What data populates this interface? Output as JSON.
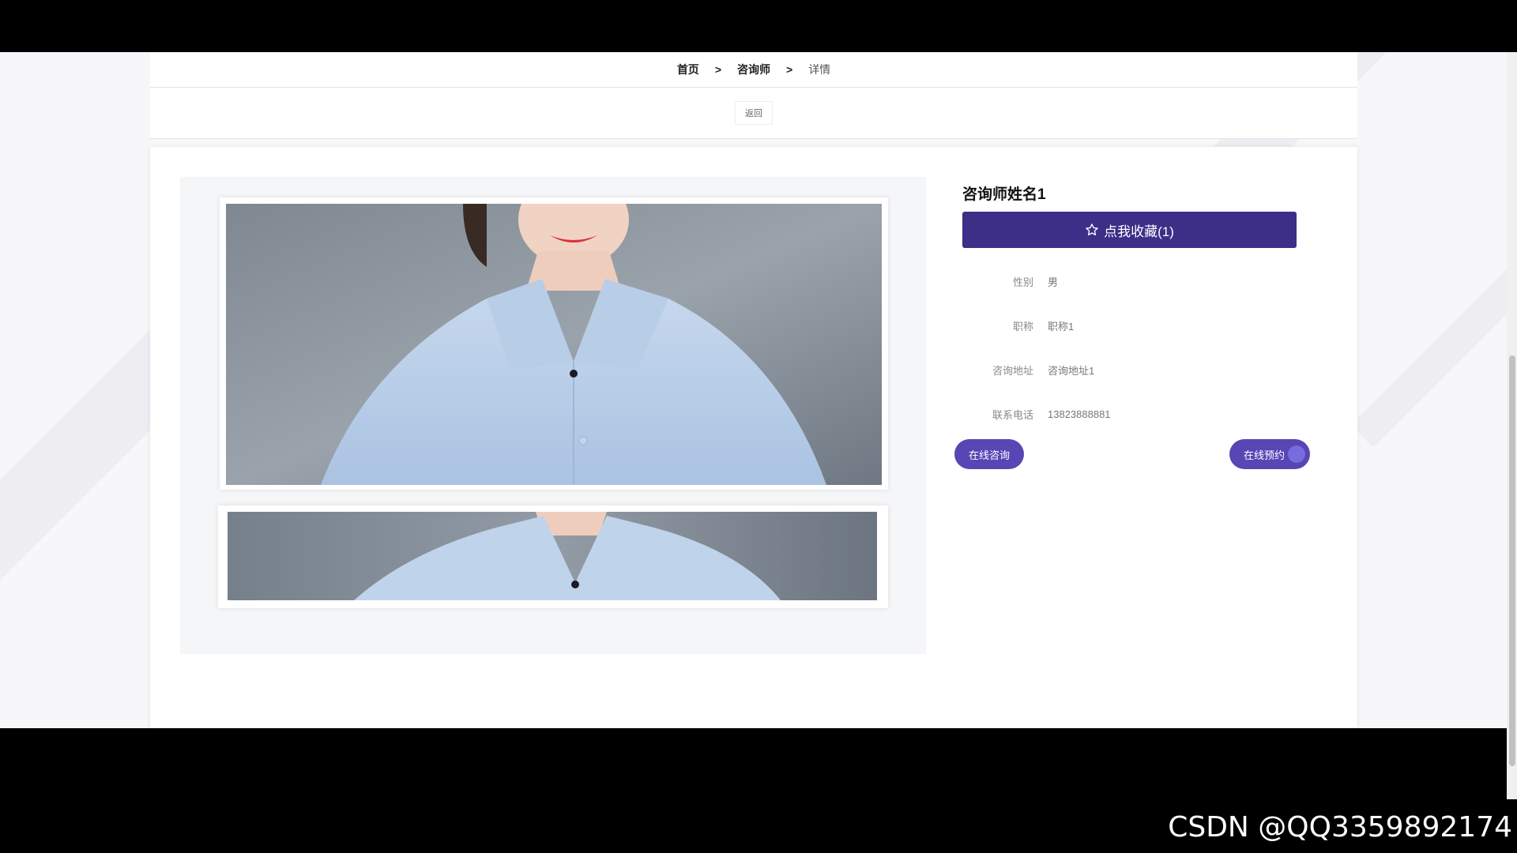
{
  "breadcrumb": {
    "home": "首页",
    "sep1": ">",
    "section": "咨询师",
    "sep2": ">",
    "current": "详情"
  },
  "back_label": "返回",
  "counselor": {
    "name": "咨询师姓名1",
    "collect_label": "点我收藏(1)",
    "fields": [
      {
        "label": "性别",
        "value": "男"
      },
      {
        "label": "职称",
        "value": "职称1"
      },
      {
        "label": "咨询地址",
        "value": "咨询地址1"
      },
      {
        "label": "联系电话",
        "value": "13823888881"
      }
    ]
  },
  "actions": {
    "consult_label": "在线咨询",
    "book_label": "在线预约"
  },
  "colors": {
    "primary": "#3d2e88",
    "pill": "#5846b4"
  },
  "watermark": "CSDN @QQ3359892174"
}
